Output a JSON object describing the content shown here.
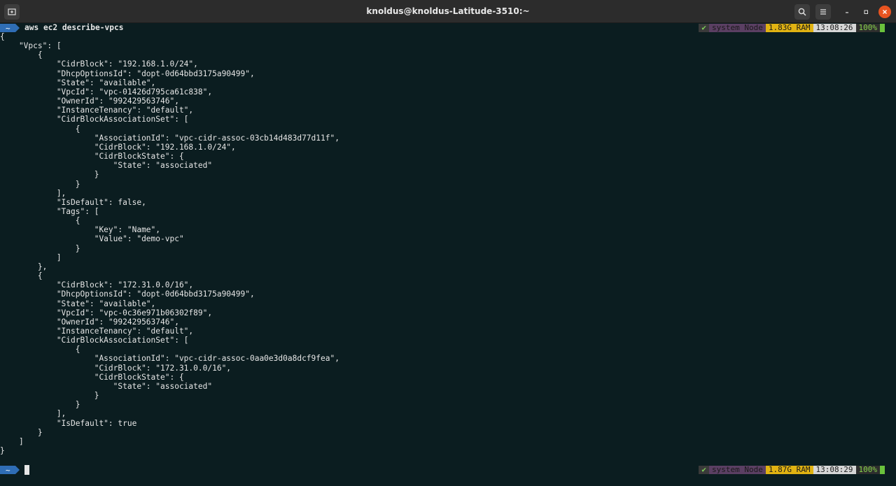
{
  "window": {
    "title": "knoldus@knoldus-Latitude-3510:~"
  },
  "icons": {
    "new_tab": "new-tab-icon",
    "search": "search-icon",
    "menu": "hamburger-menu-icon",
    "minimize": "minimize-icon",
    "maximize": "maximize-icon",
    "close": "close-icon"
  },
  "colors": {
    "background": "#0b1d20",
    "titlebar": "#2c2c2c",
    "prompt_segment": "#2f6db5",
    "close_button": "#e95420",
    "status_system": "#5b3f63",
    "status_ram": "#e1b312",
    "status_time": "#d6d6d6",
    "status_battery": "#6ac23c"
  },
  "prompt": {
    "dir": "~"
  },
  "first_command": {
    "text": "aws ec2 describe-vpcs",
    "status": {
      "check": "✔",
      "system": "system Node",
      "ram": "1.83G RAM",
      "time": "13:08:26",
      "battery": "100%"
    }
  },
  "output": "{\n    \"Vpcs\": [\n        {\n            \"CidrBlock\": \"192.168.1.0/24\",\n            \"DhcpOptionsId\": \"dopt-0d64bbd3175a90499\",\n            \"State\": \"available\",\n            \"VpcId\": \"vpc-01426d795ca61c838\",\n            \"OwnerId\": \"992429563746\",\n            \"InstanceTenancy\": \"default\",\n            \"CidrBlockAssociationSet\": [\n                {\n                    \"AssociationId\": \"vpc-cidr-assoc-03cb14d483d77d11f\",\n                    \"CidrBlock\": \"192.168.1.0/24\",\n                    \"CidrBlockState\": {\n                        \"State\": \"associated\"\n                    }\n                }\n            ],\n            \"IsDefault\": false,\n            \"Tags\": [\n                {\n                    \"Key\": \"Name\",\n                    \"Value\": \"demo-vpc\"\n                }\n            ]\n        },\n        {\n            \"CidrBlock\": \"172.31.0.0/16\",\n            \"DhcpOptionsId\": \"dopt-0d64bbd3175a90499\",\n            \"State\": \"available\",\n            \"VpcId\": \"vpc-0c36e971b06302f89\",\n            \"OwnerId\": \"992429563746\",\n            \"InstanceTenancy\": \"default\",\n            \"CidrBlockAssociationSet\": [\n                {\n                    \"AssociationId\": \"vpc-cidr-assoc-0aa0e3d0a8dcf9fea\",\n                    \"CidrBlock\": \"172.31.0.0/16\",\n                    \"CidrBlockState\": {\n                        \"State\": \"associated\"\n                    }\n                }\n            ],\n            \"IsDefault\": true\n        }\n    ]\n}",
  "second_prompt": {
    "status": {
      "check": "✔",
      "system": "system Node",
      "ram": "1.87G RAM",
      "time": "13:08:29",
      "battery": "100%"
    }
  }
}
